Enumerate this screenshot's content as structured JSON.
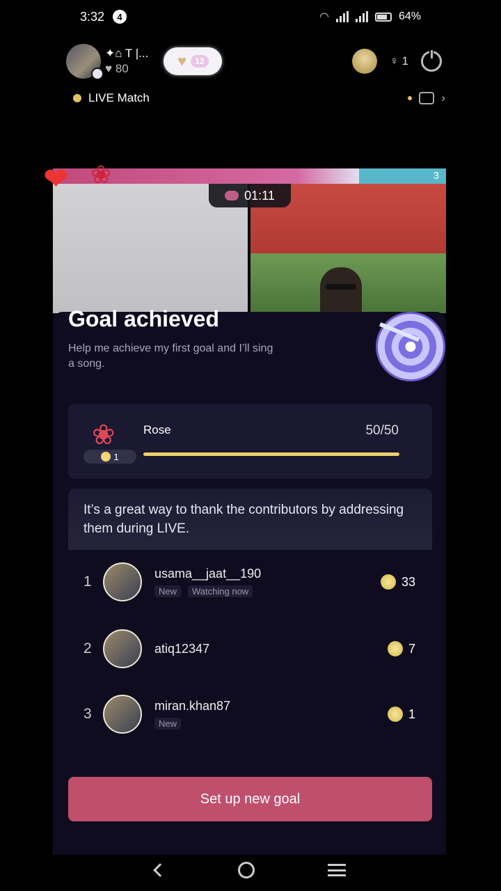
{
  "status_bar": {
    "time": "3:32",
    "notification_count": "4",
    "battery": "64%"
  },
  "header": {
    "host_name": "✦⌂ T |...",
    "host_likes": "♥ 80",
    "gift_count": "12",
    "viewer_count": "♀ 1",
    "live_match_label": "LIVE Match"
  },
  "battle": {
    "timer": "01:11",
    "right_score": "3"
  },
  "goal": {
    "title": "Goal achieved",
    "description": "Help me achieve my first goal and I’ll sing a song.",
    "gift_name": "Rose",
    "gift_price": "1",
    "progress_text": "50/50",
    "progress_fraction": 1.0
  },
  "info_text": "It’s a great way to thank the contributors by addressing them during LIVE.",
  "contributors": [
    {
      "rank": "1",
      "name": "usama__jaat__190",
      "tags": [
        "New",
        "Watching now"
      ],
      "coins": "33"
    },
    {
      "rank": "2",
      "name": "atiq12347",
      "tags": [],
      "coins": "7"
    },
    {
      "rank": "3",
      "name": "miran.khan87",
      "tags": [
        "New"
      ],
      "coins": "1"
    }
  ],
  "cta_label": "Set up new goal"
}
